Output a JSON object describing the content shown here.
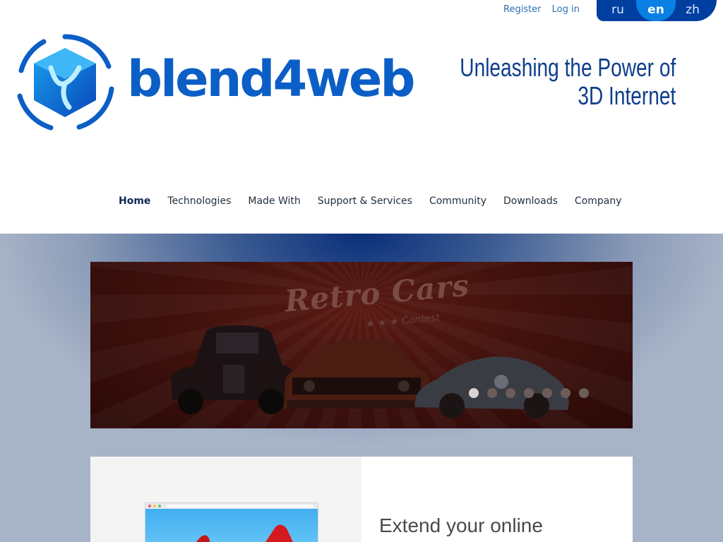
{
  "auth": {
    "register": "Register",
    "login": "Log in"
  },
  "languages": [
    {
      "code": "ru",
      "active": false
    },
    {
      "code": "en",
      "active": true
    },
    {
      "code": "zh",
      "active": false
    }
  ],
  "logo": {
    "wordmark": "blend4web",
    "icon": "blend4web-cube-logo"
  },
  "tagline": {
    "line1": "Unleashing the Power of",
    "line2": "3D Internet"
  },
  "nav": [
    {
      "label": "Home",
      "active": true
    },
    {
      "label": "Technologies",
      "active": false
    },
    {
      "label": "Made With",
      "active": false
    },
    {
      "label": "Support & Services",
      "active": false
    },
    {
      "label": "Community",
      "active": false
    },
    {
      "label": "Downloads",
      "active": false
    },
    {
      "label": "Company",
      "active": false
    }
  ],
  "slider": {
    "title": "Retro Cars",
    "subtitle": "★ ★ ★ Contest",
    "dots": 7,
    "active_dot": 1
  },
  "info": {
    "heading": "Extend your online"
  },
  "colors": {
    "brand_blue": "#0b5ec6",
    "tagline_blue": "#0e3f8c",
    "link_blue": "#2a6fb0",
    "lang_bar": "#003ea0",
    "lang_active": "#0a7fe4"
  }
}
